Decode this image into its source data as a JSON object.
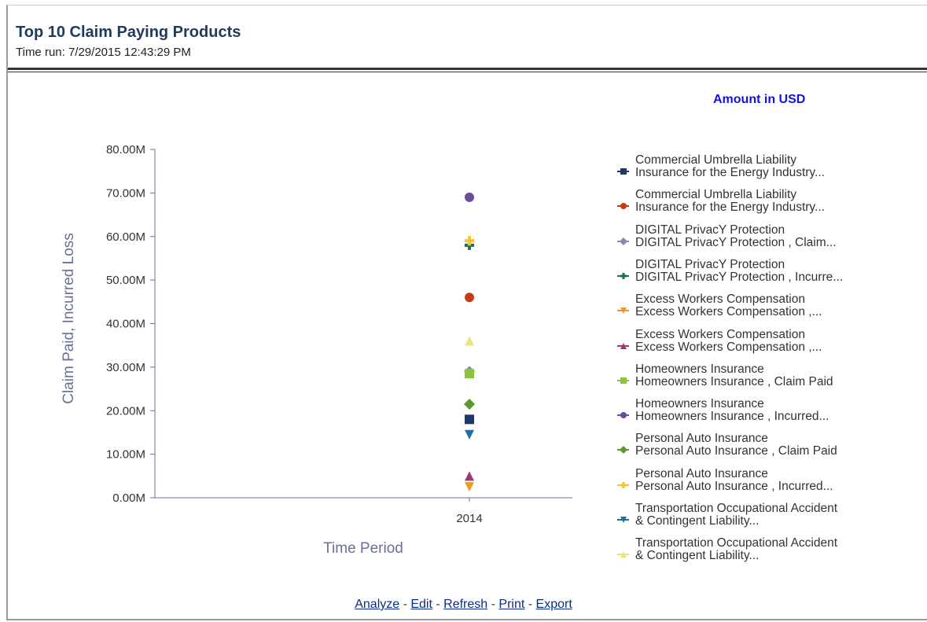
{
  "header": {
    "title": "Top 10 Claim Paying Products",
    "time_run": "Time run: 7/29/2015 12:43:29 PM"
  },
  "unit_label": "Amount in USD",
  "chart_data": {
    "type": "scatter",
    "title": "",
    "xlabel": "Time Period",
    "ylabel": "Claim Paid, Incurred Loss",
    "categories": [
      "2014"
    ],
    "ylim": [
      0,
      80
    ],
    "yticks": [
      "0.00M",
      "10.00M",
      "20.00M",
      "30.00M",
      "40.00M",
      "50.00M",
      "60.00M",
      "70.00M",
      "80.00M"
    ],
    "grid": false,
    "legend_position": "right",
    "series": [
      {
        "name": "Commercial Umbrella Liability\nInsurance for the Energy Industry...",
        "values": [
          18
        ],
        "color": "#1f3864",
        "marker": "square"
      },
      {
        "name": "Commercial Umbrella Liability\nInsurance for the Energy Industry...",
        "values": [
          46
        ],
        "color": "#c93a14",
        "marker": "circle"
      },
      {
        "name": "DIGITAL PrivacY Protection\nDIGITAL PrivacY Protection , Claim...",
        "values": [
          29
        ],
        "color": "#8a86b8",
        "marker": "diamond"
      },
      {
        "name": "DIGITAL PrivacY Protection\nDIGITAL PrivacY Protection , Incurre...",
        "values": [
          58
        ],
        "color": "#1f6e5a",
        "marker": "plus"
      },
      {
        "name": "Excess Workers Compensation\nExcess Workers Compensation ,...",
        "values": [
          2.5
        ],
        "color": "#f39a1b",
        "marker": "triangle-down"
      },
      {
        "name": "Excess Workers Compensation\nExcess Workers Compensation ,...",
        "values": [
          5
        ],
        "color": "#9b3970",
        "marker": "triangle-up"
      },
      {
        "name": "Homeowners Insurance\nHomeowners Insurance , Claim Paid",
        "values": [
          28.5
        ],
        "color": "#8cc43c",
        "marker": "square"
      },
      {
        "name": "Homeowners Insurance\nHomeowners Insurance , Incurred...",
        "values": [
          69
        ],
        "color": "#6a4b9c",
        "marker": "circle"
      },
      {
        "name": "Personal Auto Insurance\nPersonal Auto Insurance , Claim Paid",
        "values": [
          21.5
        ],
        "color": "#5b9a2a",
        "marker": "diamond"
      },
      {
        "name": "Personal Auto Insurance\nPersonal Auto Insurance , Incurred...",
        "values": [
          59
        ],
        "color": "#f7c42e",
        "marker": "plus"
      },
      {
        "name": "Transportation Occupational Accident\n& Contingent Liability...",
        "values": [
          14.5
        ],
        "color": "#1d6fa5",
        "marker": "triangle-down"
      },
      {
        "name": "Transportation Occupational Accident\n& Contingent Liability...",
        "values": [
          36
        ],
        "color": "#ece47a",
        "marker": "triangle-up"
      }
    ]
  },
  "footer": {
    "analyze": "Analyze",
    "edit": "Edit",
    "refresh": "Refresh",
    "print": "Print",
    "export": "Export",
    "separator": " - "
  }
}
